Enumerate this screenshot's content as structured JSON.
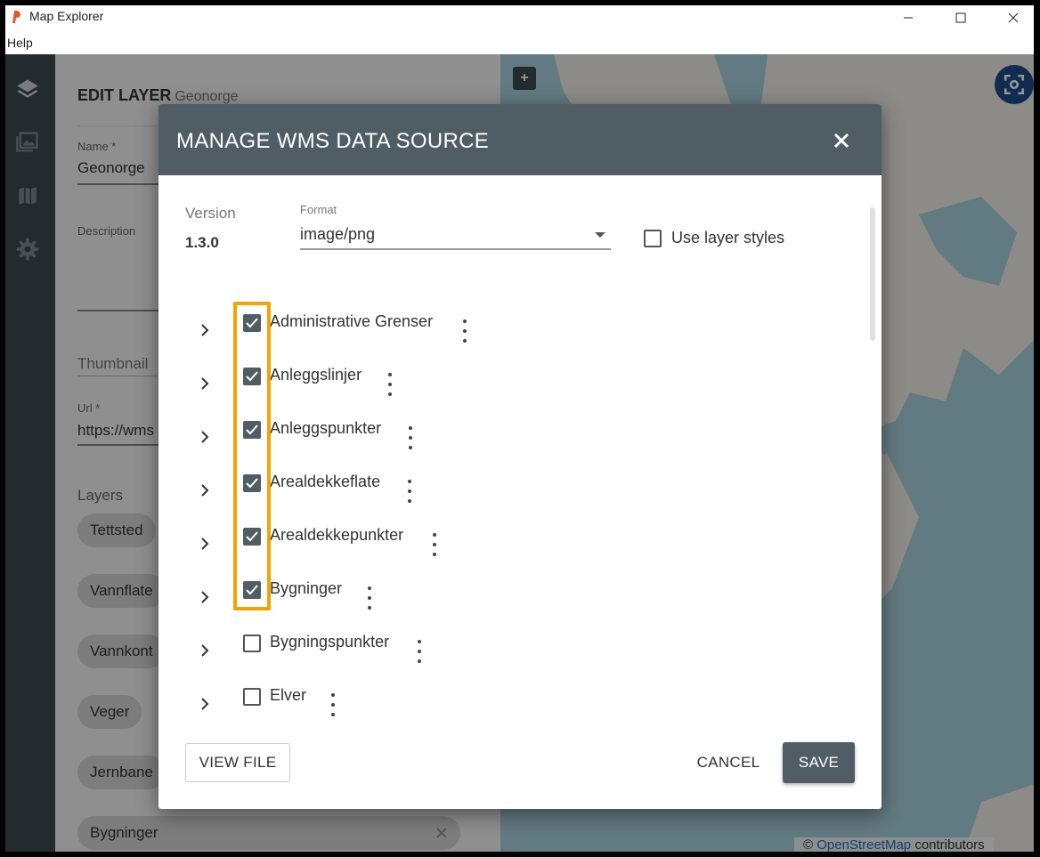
{
  "window": {
    "title": "Map Explorer",
    "menu_help": "Help"
  },
  "edit_panel": {
    "heading": "EDIT LAYER",
    "heading_sub": "Geonorge",
    "name_label": "Name *",
    "name_value": "Geonorge",
    "description_label": "Description",
    "thumbnail_label": "Thumbnail",
    "url_label": "Url *",
    "url_value": "https://wms",
    "layers_label": "Layers",
    "chips": [
      "Tettsted",
      "Vannflate",
      "Vannkont",
      "Veger",
      "Jernbane",
      "Bygninger"
    ]
  },
  "map": {
    "zoom_in": "+",
    "attribution_symbol": "©",
    "attribution_link": "OpenStreetMap",
    "attribution_text": "contributors",
    "colors": {
      "sea": "#aad3df",
      "land": "#f2efe9"
    }
  },
  "dialog": {
    "title": "MANAGE WMS DATA SOURCE",
    "version_label": "Version",
    "version_value": "1.3.0",
    "format_label": "Format",
    "format_value": "image/png",
    "use_layer_styles_label": "Use layer styles",
    "use_layer_styles_checked": false,
    "layers": [
      {
        "label": "Administrative Grenser",
        "checked": true
      },
      {
        "label": "Anleggslinjer",
        "checked": true
      },
      {
        "label": "Anleggspunkter",
        "checked": true
      },
      {
        "label": "Arealdekkeflate",
        "checked": true
      },
      {
        "label": "Arealdekkepunkter",
        "checked": true
      },
      {
        "label": "Bygninger",
        "checked": true
      },
      {
        "label": "Bygningspunkter",
        "checked": false
      },
      {
        "label": "Elver",
        "checked": false
      }
    ],
    "view_file_label": "VIEW FILE",
    "cancel_label": "CANCEL",
    "save_label": "SAVE",
    "colors": {
      "header": "#515d65",
      "highlight": "#f5a300"
    }
  }
}
